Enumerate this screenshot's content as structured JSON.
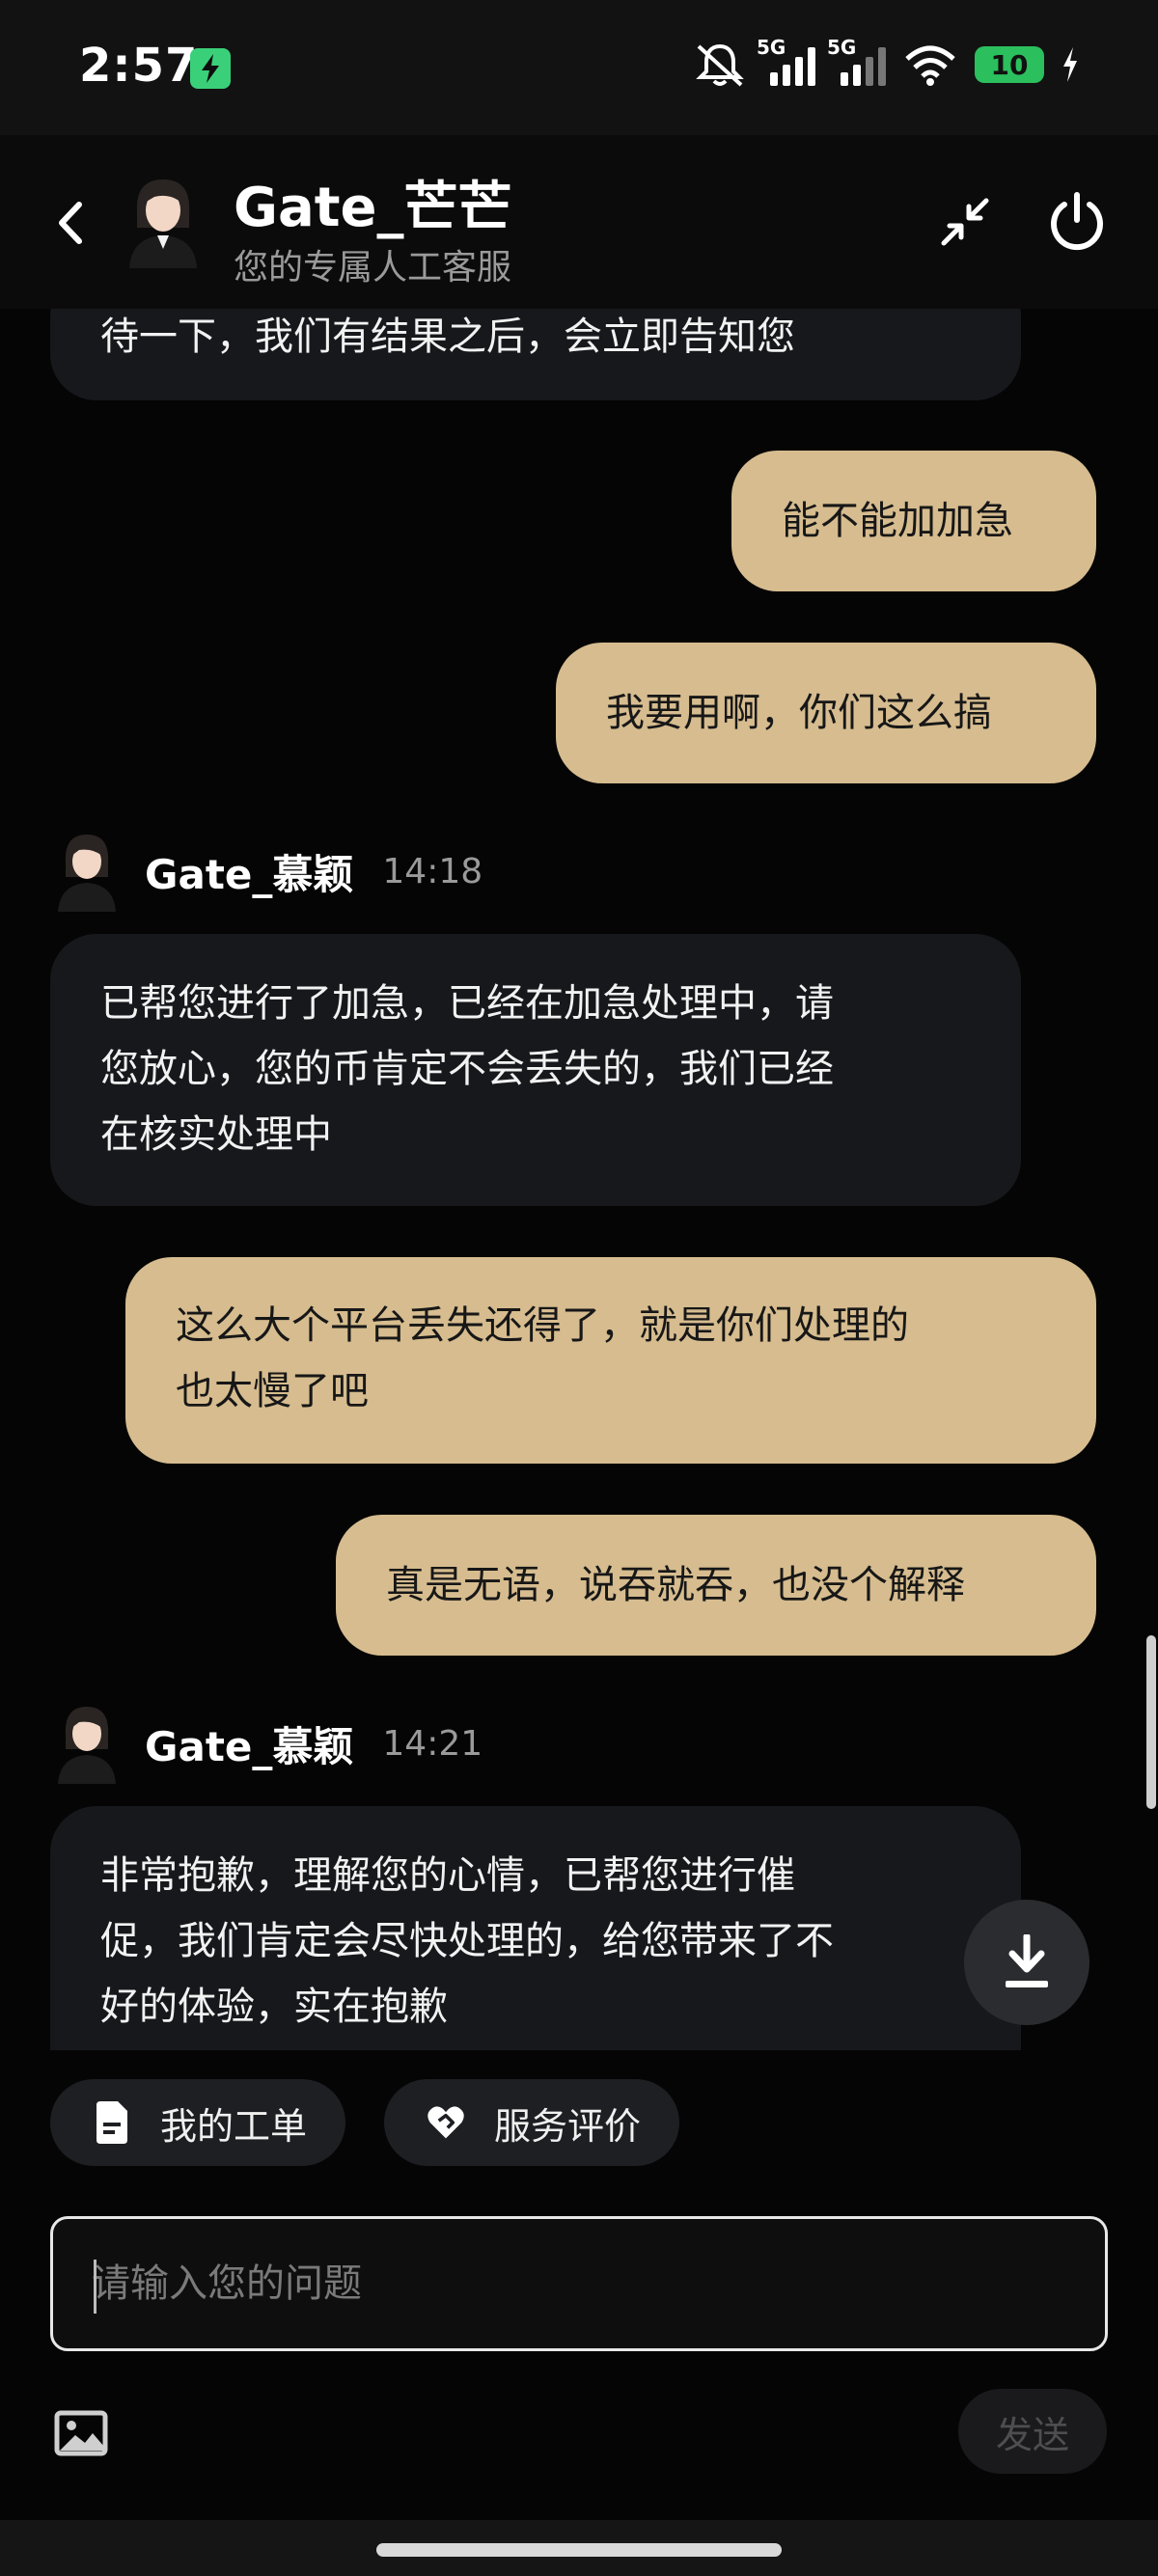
{
  "status_bar": {
    "time": "2:57",
    "battery_level": "10",
    "network_1": "5G",
    "network_2": "5G"
  },
  "header": {
    "title": "Gate_芒芒",
    "subtitle": "您的专属人工客服"
  },
  "messages": [
    {
      "sender": "agent",
      "lines": [
        "待一下，我们有结果之后，会立即告知您"
      ]
    },
    {
      "sender": "user",
      "lines": [
        "能不能加加急"
      ]
    },
    {
      "sender": "user",
      "lines": [
        "我要用啊，你们这么搞"
      ]
    },
    {
      "sender": "agent",
      "name": "Gate_慕颖",
      "time": "14:18",
      "lines": [
        "已帮您进行了加急，已经在加急处理中，请",
        "您放心，您的币肯定不会丢失的，我们已经",
        "在核实处理中"
      ]
    },
    {
      "sender": "user",
      "lines": [
        "这么大个平台丢失还得了，就是你们处理的",
        "也太慢了吧"
      ]
    },
    {
      "sender": "user",
      "lines": [
        "真是无语，说吞就吞，也没个解释"
      ]
    },
    {
      "sender": "agent",
      "name": "Gate_慕颖",
      "time": "14:21",
      "lines": [
        "非常抱歉，理解您的心情，已帮您进行催",
        "促，我们肯定会尽快处理的，给您带来了不",
        "好的体验，实在抱歉"
      ]
    }
  ],
  "quick_actions": {
    "tickets": "我的工单",
    "rating": "服务评价"
  },
  "composer": {
    "placeholder": "请输入您的问题",
    "send_label": "发送"
  },
  "colors": {
    "user_bubble": "#d6bc8f",
    "agent_bubble": "#17181c",
    "background": "#050505"
  }
}
